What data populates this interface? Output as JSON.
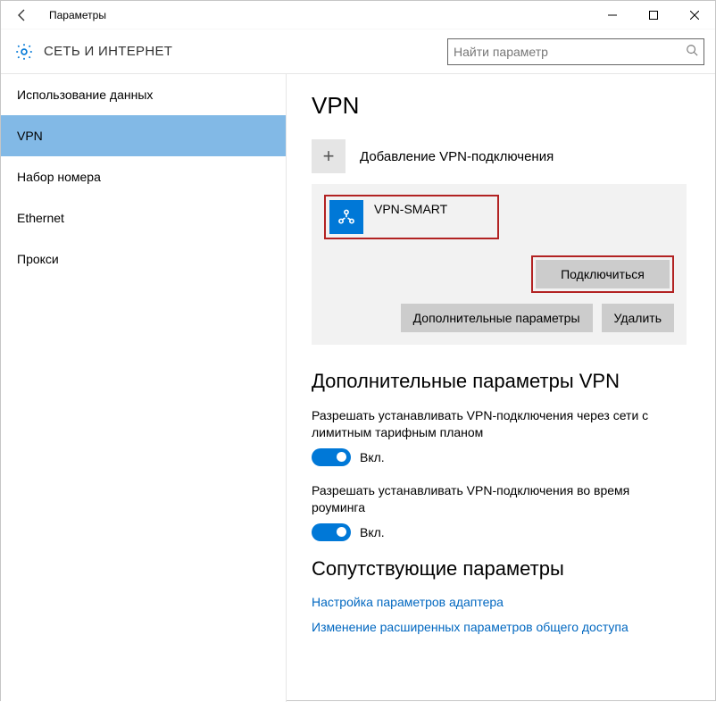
{
  "window": {
    "title": "Параметры"
  },
  "header": {
    "section_title": "СЕТЬ И ИНТЕРНЕТ",
    "search_placeholder": "Найти параметр"
  },
  "sidebar": {
    "items": [
      {
        "label": "Использование данных",
        "selected": false
      },
      {
        "label": "VPN",
        "selected": true
      },
      {
        "label": "Набор номера",
        "selected": false
      },
      {
        "label": "Ethernet",
        "selected": false
      },
      {
        "label": "Прокси",
        "selected": false
      }
    ]
  },
  "content": {
    "page_title": "VPN",
    "add_vpn_label": "Добавление VPN-подключения",
    "connection": {
      "name": "VPN-SMART",
      "connect_label": "Подключиться",
      "extra_label": "Дополнительные параметры",
      "delete_label": "Удалить"
    },
    "advanced_title": "Дополнительные параметры VPN",
    "settings": [
      {
        "desc": "Разрешать устанавливать VPN-подключения через сети с лимитным тарифным планом",
        "state_label": "Вкл."
      },
      {
        "desc": "Разрешать устанавливать VPN-подключения во время роуминга",
        "state_label": "Вкл."
      }
    ],
    "related_title": "Сопутствующие параметры",
    "links": [
      "Настройка параметров адаптера",
      "Изменение расширенных параметров общего доступа"
    ]
  }
}
